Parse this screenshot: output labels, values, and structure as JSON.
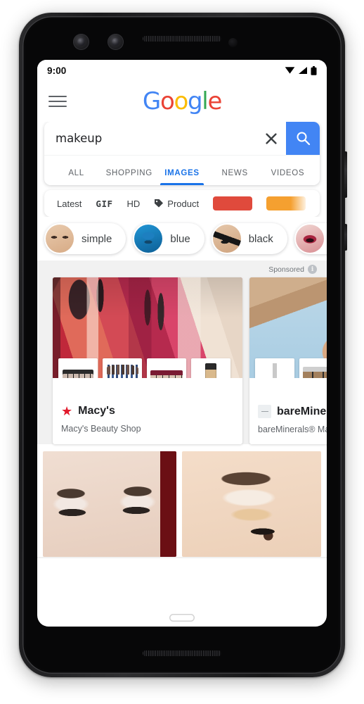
{
  "device": {
    "name": "google-pixel-phone",
    "cameras": [
      "front-camera-1",
      "front-camera-2"
    ],
    "sensor": "proximity-sensor",
    "speaker": "earpiece-speaker",
    "bottom_speaker": "bottom-speaker-grille",
    "power_button": "power-button",
    "volume_button": "volume-button",
    "home_indicator": "home-indicator"
  },
  "status_bar": {
    "time": "9:00",
    "icons": [
      "wifi-icon",
      "cell-signal-icon",
      "battery-icon"
    ]
  },
  "header": {
    "menu_icon": "hamburger-menu-icon",
    "logo": {
      "text": "Google",
      "letters": [
        "G",
        "o",
        "o",
        "g",
        "l",
        "e"
      ],
      "colors": [
        "#4285F4",
        "#EA4335",
        "#FBBC05",
        "#4285F4",
        "#34A853",
        "#EA4335"
      ]
    }
  },
  "search": {
    "query": "makeup",
    "placeholder": "Search",
    "clear_icon": "close-icon",
    "submit_icon": "search-icon",
    "submit_color": "#4285F4"
  },
  "tabs": [
    {
      "label": "ALL",
      "active": false
    },
    {
      "label": "SHOPPING",
      "active": false
    },
    {
      "label": "IMAGES",
      "active": true
    },
    {
      "label": "NEWS",
      "active": false
    },
    {
      "label": "VIDEOS",
      "active": false
    }
  ],
  "tab_accent": "#1a73e8",
  "filters": [
    {
      "label": "Latest",
      "icon": null
    },
    {
      "label": "GIF",
      "icon": null
    },
    {
      "label": "HD",
      "icon": null
    },
    {
      "label": "Product",
      "icon": "tag-icon"
    }
  ],
  "color_swatches": [
    {
      "name": "red-swatch",
      "color": "#E04A3C"
    },
    {
      "name": "orange-swatch",
      "color": "#F5A030"
    }
  ],
  "suggestion_chips": [
    {
      "label": "simple",
      "thumb": "t-simple"
    },
    {
      "label": "blue",
      "thumb": "t-blue"
    },
    {
      "label": "black",
      "thumb": "t-black"
    },
    {
      "label": "",
      "thumb": "t-red"
    }
  ],
  "sponsored": {
    "label": "Sponsored",
    "info_icon": "info-icon",
    "info_glyph": "i"
  },
  "ads": [
    {
      "brand": "Macy's",
      "description": "Macy's Beauty Shop",
      "logo": "macys-star-logo",
      "logo_glyph": "★",
      "logo_color": "#E21A2C",
      "hero_image": "macys-makeup-hero-image",
      "thumbs": [
        "eyeshadow-palette-thumb",
        "makeup-brush-set-thumb",
        "eyeshadow-palette-wide-thumb",
        "foundation-bottle-thumb"
      ]
    },
    {
      "brand": "bareMinerals",
      "description": "bareMinerals® Ma",
      "logo": "bareminerals-logo",
      "hero_image": "bareminerals-model-hero-image",
      "thumbs": [
        "eyeliner-pencil-thumb",
        "eyeshadow-quad-thumb"
      ]
    }
  ],
  "image_results": [
    {
      "name": "eye-makeup-result-1",
      "alt": "closed eyes with smokey eyeshadow"
    },
    {
      "name": "eye-makeup-result-2",
      "alt": "eyebrow and gold eyeshadow closeup"
    }
  ]
}
